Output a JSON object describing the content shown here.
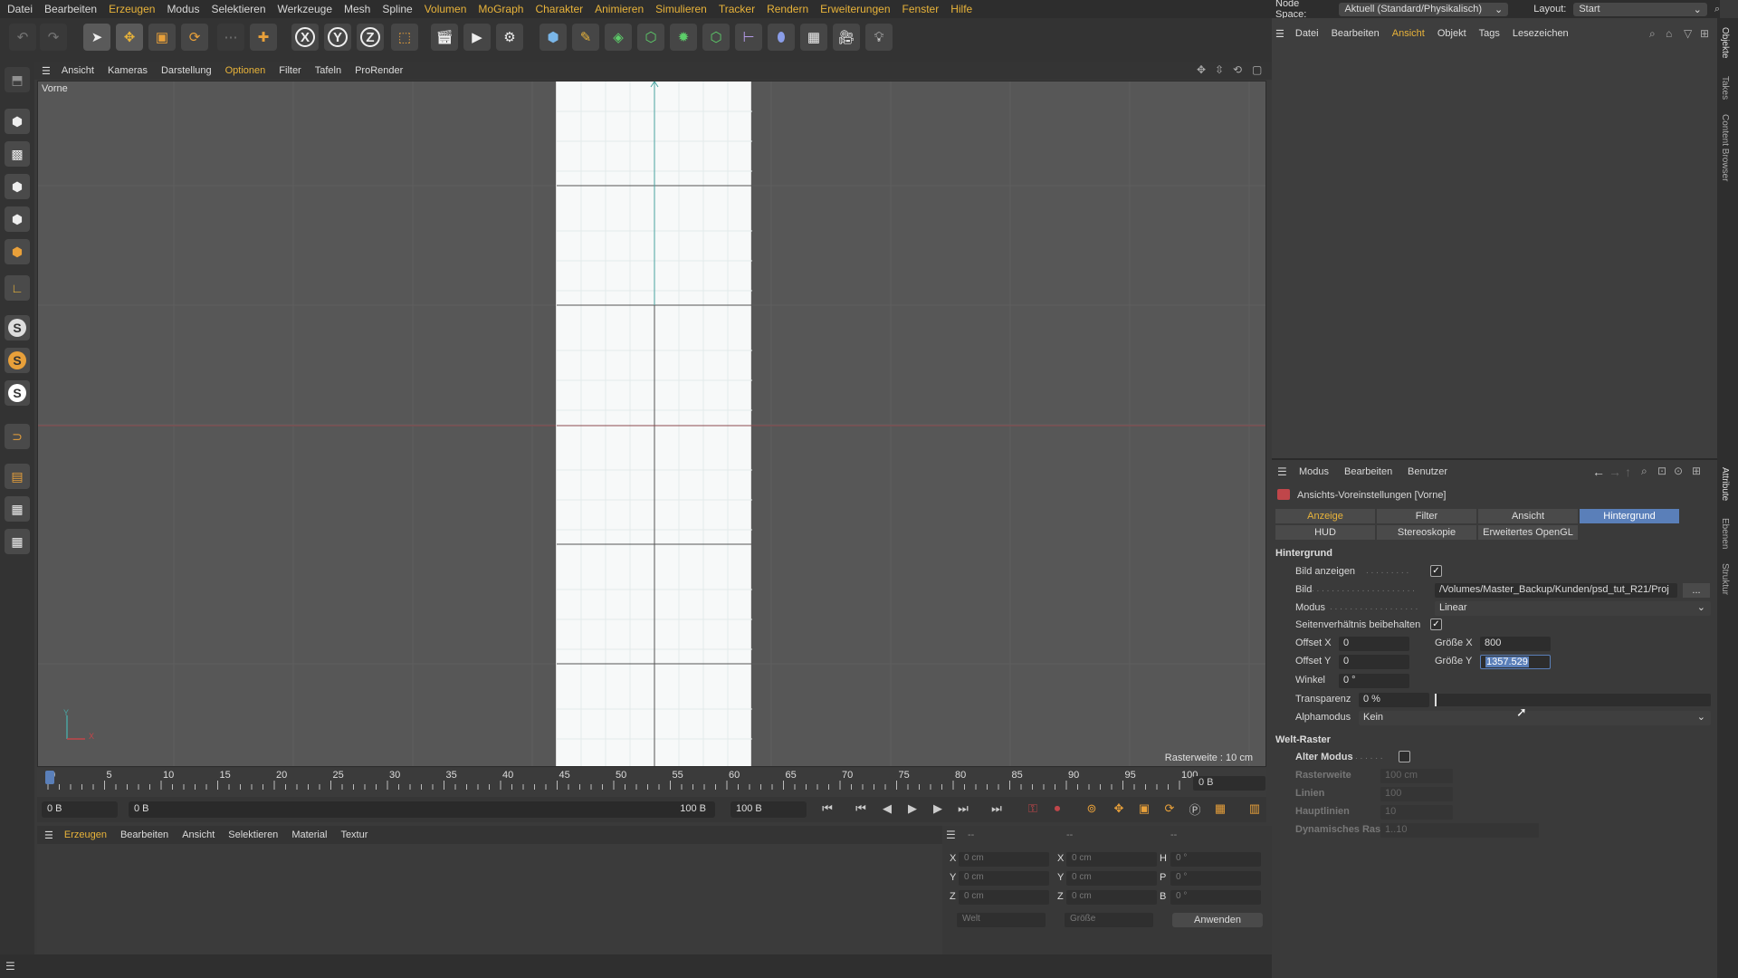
{
  "menu": [
    "Datei",
    "Bearbeiten",
    "Erzeugen",
    "Modus",
    "Selektieren",
    "Werkzeuge",
    "Mesh",
    "Spline",
    "Volumen",
    "MoGraph",
    "Charakter",
    "Animieren",
    "Simulieren",
    "Tracker",
    "Rendern",
    "Erweiterungen",
    "Fenster",
    "Hilfe"
  ],
  "header": {
    "node_space_label": "Node Space:",
    "node_space_value": "Aktuell (Standard/Physikalisch)",
    "layout_label": "Layout:",
    "layout_value": "Start"
  },
  "toolbar": {
    "axis_x": "X",
    "axis_y": "Y",
    "axis_z": "Z"
  },
  "viewport": {
    "menu": [
      "Ansicht",
      "Kameras",
      "Darstellung",
      "Optionen",
      "Filter",
      "Tafeln",
      "ProRender"
    ],
    "view_name": "Vorne",
    "grid_label": "Rasterweite : 10 cm",
    "axis_y": "Y",
    "axis_x": "X"
  },
  "timeline": {
    "ticks": [
      "0",
      "5",
      "10",
      "15",
      "20",
      "25",
      "30",
      "35",
      "40",
      "45",
      "50",
      "55",
      "60",
      "65",
      "70",
      "75",
      "80",
      "85",
      "90",
      "95",
      "100"
    ],
    "current_frame": "0 B",
    "start_field": "0 B",
    "range_start": "0 B",
    "range_end": "100 B",
    "end_field": "100 B"
  },
  "materials": {
    "menu": [
      "Erzeugen",
      "Bearbeiten",
      "Ansicht",
      "Selektieren",
      "Material",
      "Textur"
    ]
  },
  "coords": {
    "headers": [
      "--",
      "--",
      "--"
    ],
    "pos_labels": [
      "X",
      "Y",
      "Z"
    ],
    "rot_labels": [
      "H",
      "P",
      "B"
    ],
    "pos_values": [
      "0 cm",
      "0 cm",
      "0 cm"
    ],
    "size_values": [
      "0 cm",
      "0 cm",
      "0 cm"
    ],
    "rot_values": [
      "0 °",
      "0 °",
      "0 °"
    ],
    "mode_world": "Welt",
    "mode_size": "Größe",
    "apply_button": "Anwenden"
  },
  "objects": {
    "menu": [
      "Datei",
      "Bearbeiten",
      "Ansicht",
      "Objekt",
      "Tags",
      "Lesezeichen"
    ]
  },
  "right_tabs": [
    "Objekte",
    "Takes",
    "Content Browser",
    "Attribute",
    "Ebenen",
    "Struktur"
  ],
  "attributes": {
    "menu": [
      "Modus",
      "Bearbeiten",
      "Benutzer"
    ],
    "title": "Ansichts-Voreinstellungen [Vorne]",
    "tabs_row1": [
      "Anzeige",
      "Filter",
      "Ansicht",
      "Hintergrund"
    ],
    "tabs_row2": [
      "HUD",
      "Stereoskopie",
      "Erweitertes OpenGL"
    ],
    "section_bg": "Hintergrund",
    "bild_anzeigen": "Bild anzeigen",
    "bild_label": "Bild",
    "bild_path": "/Volumes/Master_Backup/Kunden/psd_tut_R21/Proj",
    "bild_browse": "...",
    "modus_label": "Modus",
    "modus_value": "Linear",
    "aspect_label": "Seitenverhältnis beibehalten",
    "offset_x_label": "Offset X",
    "offset_x": "0",
    "offset_y_label": "Offset Y",
    "offset_y": "0",
    "groesse_x_label": "Größe X",
    "groesse_x": "800",
    "groesse_y_label": "Größe Y",
    "groesse_y": "1357.529",
    "winkel_label": "Winkel",
    "winkel": "0 °",
    "transparenz_label": "Transparenz",
    "transparenz": "0 %",
    "alphamodus_label": "Alphamodus",
    "alphamodus": "Kein",
    "section_grid": "Welt-Raster",
    "alter_modus": "Alter Modus",
    "rasterweite_label": "Rasterweite",
    "rasterweite": "100 cm",
    "linien_label": "Linien",
    "linien": "100",
    "hauptlinien_label": "Hauptlinien",
    "hauptlinien": "10",
    "dyn_raster_label": "Dynamisches Raster",
    "dyn_raster": "1..10"
  },
  "colors": {
    "accent": "#e8b33a",
    "active_tab": "#5a7fb9",
    "x_axis": "#c0464a",
    "y_axis": "#4aa3a0"
  }
}
